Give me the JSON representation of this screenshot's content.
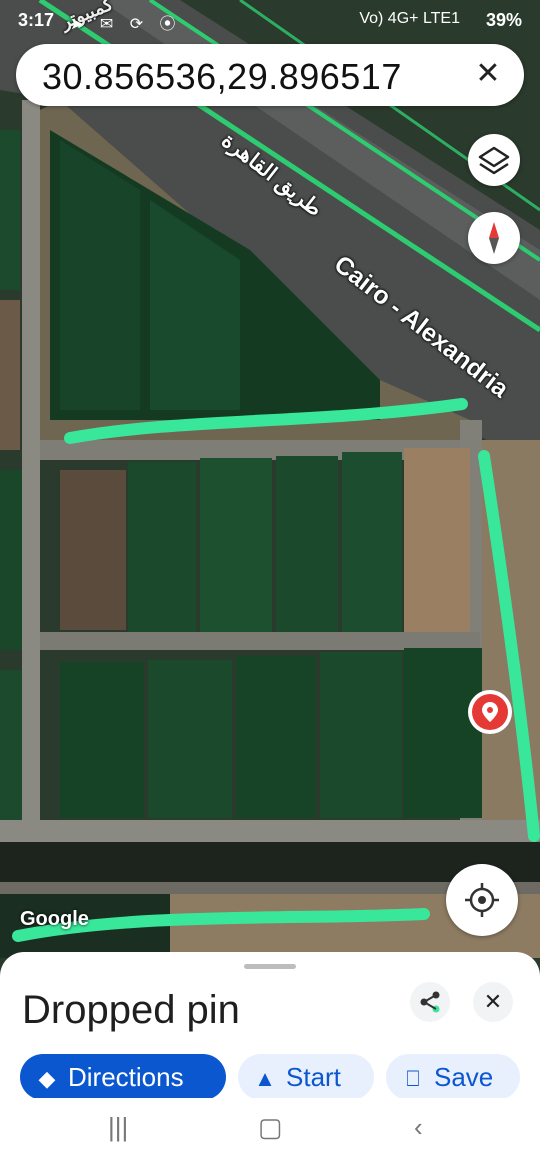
{
  "status": {
    "time": "3:17",
    "battery": "39%",
    "network": "Vo) 4G+ LTE1",
    "notif_icons": "➤ ✉ ⟳ ⦿"
  },
  "search": {
    "query": "30.856536,29.896517",
    "close_icon": "close-icon"
  },
  "map": {
    "road_label_en": "Cairo - Alexandria",
    "road_label_ar": "طريق القاهرة",
    "road_label_ar_top": "كمبيوتر",
    "google_logo": "Google",
    "colors": {
      "highlight": "#39e79a",
      "road_outline": "#2ecc71",
      "field": "#1c4a2b",
      "pin": "#e53935"
    }
  },
  "controls": {
    "layers_icon": "layers-icon",
    "compass_icon": "compass-icon",
    "locate_icon": "my-location-icon"
  },
  "sheet": {
    "title": "Dropped pin",
    "share_icon": "share-icon",
    "close_icon": "close-icon",
    "actions": {
      "directions": "Directions",
      "start": "Start",
      "save": "Save"
    }
  },
  "navbar": {
    "recents_icon": "recents-icon",
    "home_icon": "home-icon",
    "back_icon": "back-icon"
  }
}
